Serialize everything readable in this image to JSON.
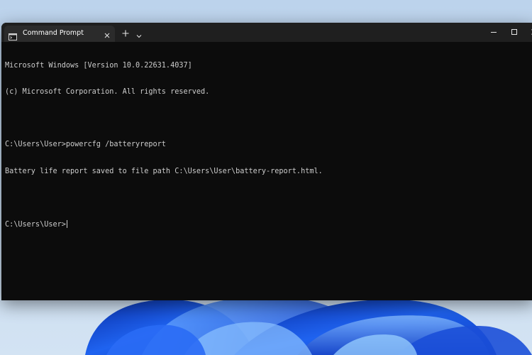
{
  "window": {
    "tab_title": "Command Prompt",
    "tab_icon": "terminal-icon",
    "controls": {
      "close_tab": "close-icon",
      "new_tab": "plus-icon",
      "dropdown": "chevron-down-icon",
      "minimize": "minimize-icon",
      "maximize": "maximize-icon",
      "close": "close-icon"
    }
  },
  "console": {
    "lines": [
      "Microsoft Windows [Version 10.0.22631.4037]",
      "(c) Microsoft Corporation. All rights reserved.",
      "",
      "C:\\Users\\User>powercfg /batteryreport",
      "Battery life report saved to file path C:\\Users\\User\\battery-report.html.",
      ""
    ],
    "prompt": "C:\\Users\\User>",
    "input_value": ""
  },
  "colors": {
    "console_bg": "#0c0c0c",
    "titlebar_bg": "#1f1f1f",
    "tab_bg": "#2b2b2b",
    "text": "#cccccc",
    "wallpaper_accent": "#1a56e0"
  }
}
